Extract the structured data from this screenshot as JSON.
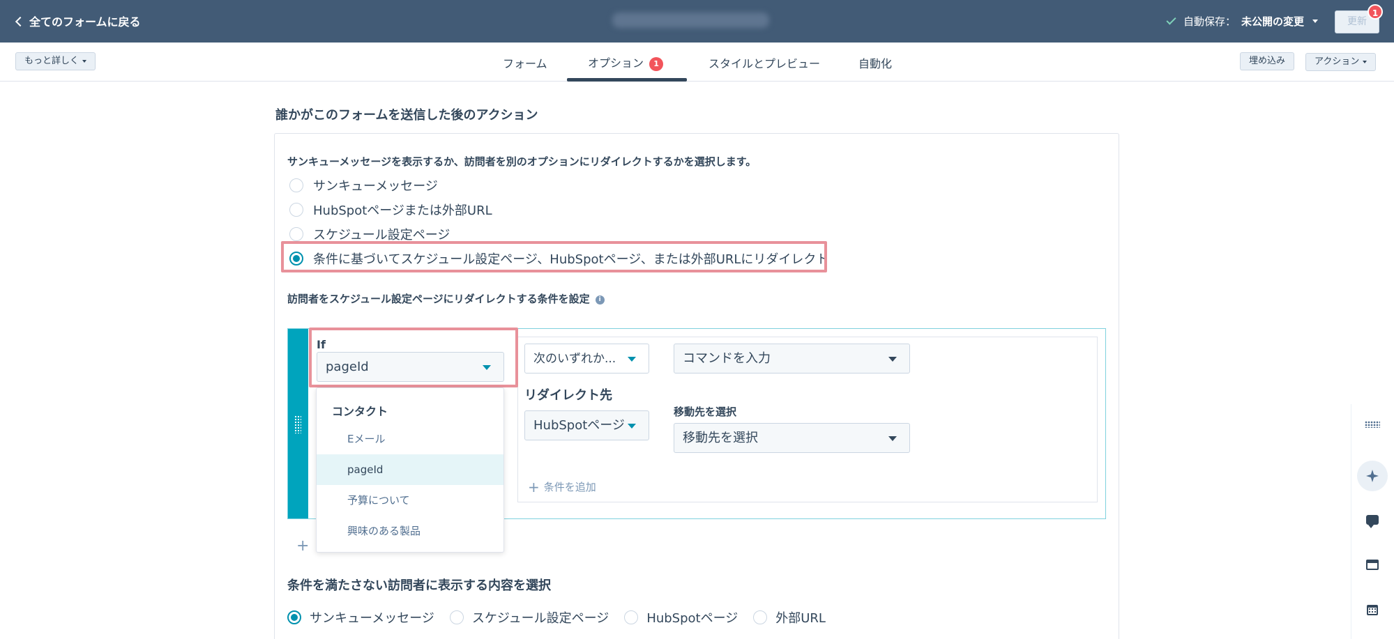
{
  "header": {
    "back_label": "全てのフォームに戻る",
    "autosave_label": "自動保存：",
    "autosave_status": "未公開の変更",
    "update_button": "更新",
    "notification_count": "1"
  },
  "toolbar": {
    "more_details": "もっと詳しく",
    "embed": "埋め込み",
    "actions": "アクション"
  },
  "tabs": [
    {
      "label": "フォーム"
    },
    {
      "label": "オプション",
      "badge": "1"
    },
    {
      "label": "スタイルとプレビュー"
    },
    {
      "label": "自動化"
    }
  ],
  "main": {
    "section_title": "誰かがこのフォームを送信した後のアクション",
    "choose_label": "サンキューメッセージを表示するか、訪問者を別のオプションにリダイレクトするかを選択します。",
    "options": [
      {
        "label": "サンキューメッセージ",
        "selected": false
      },
      {
        "label": "HubSpotページまたは外部URL",
        "selected": false
      },
      {
        "label": "スケジュール設定ページ",
        "selected": false
      },
      {
        "label": "条件に基づいてスケジュール設定ページ、HubSpotページ、または外部URLにリダイレクト",
        "selected": true
      }
    ],
    "condition_title": "訪問者をスケジュール設定ページにリダイレクトする条件を設定"
  },
  "condition": {
    "if_label": "If",
    "property_value": "pageId",
    "operator_value": "次のいずれか...",
    "value_placeholder": "コマンドを入力",
    "redirect_label": "リダイレクト先",
    "redirect_type": "HubSpotページ",
    "destination_label": "移動先を選択",
    "destination_placeholder": "移動先を選択",
    "add_condition": "条件を追加",
    "add_rule": "+"
  },
  "dropdown": {
    "group": "コンタクト",
    "items": [
      {
        "label": "Eメール",
        "active": false
      },
      {
        "label": "pageId",
        "active": true
      },
      {
        "label": "予算について",
        "active": false
      },
      {
        "label": "興味のある製品",
        "active": false
      }
    ]
  },
  "fallback": {
    "title": "条件を満たさない訪問者に表示する内容を選択",
    "options": [
      {
        "label": "サンキューメッセージ",
        "selected": true
      },
      {
        "label": "スケジュール設定ページ",
        "selected": false
      },
      {
        "label": "HubSpotページ",
        "selected": false
      },
      {
        "label": "外部URL",
        "selected": false
      }
    ]
  },
  "colors": {
    "header_bg": "#425b76",
    "accent": "#0091ae",
    "highlight": "#e8919a",
    "badge": "#f2545b",
    "condition_bar": "#00a4bd"
  },
  "rail_icons": [
    "grid-icon",
    "sparkle-icon",
    "chat-icon",
    "window-icon",
    "calendar-icon"
  ]
}
